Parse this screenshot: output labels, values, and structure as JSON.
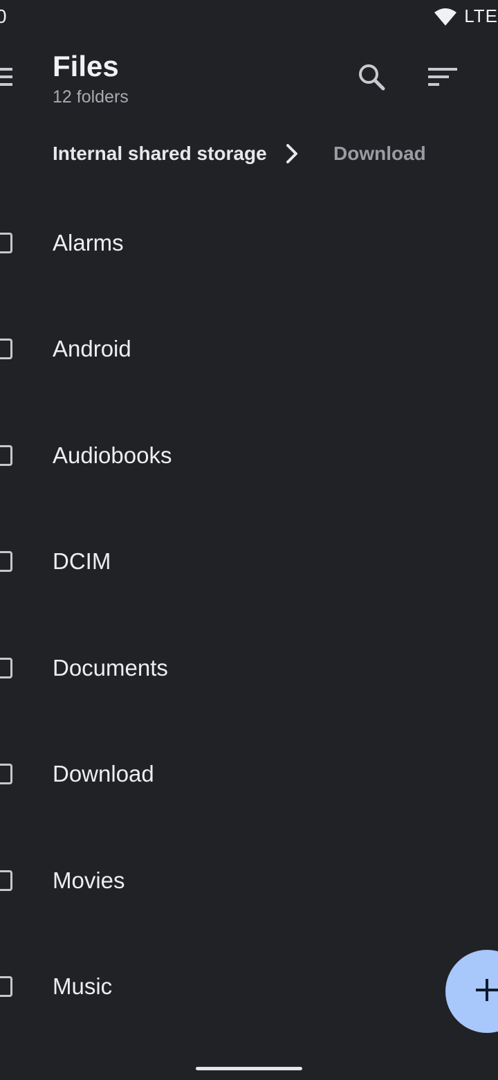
{
  "status_bar": {
    "time": "0",
    "network": "LTE",
    "icons": [
      "wifi-icon"
    ]
  },
  "app_bar": {
    "title": "Files",
    "subtitle": "12 folders",
    "icons": [
      "menu-icon",
      "search-icon",
      "sort-icon"
    ]
  },
  "breadcrumb": {
    "root": "Internal shared storage",
    "current": "Download",
    "separator_icon": "chevron-right-icon"
  },
  "folders": [
    {
      "name": "Alarms"
    },
    {
      "name": "Android"
    },
    {
      "name": "Audiobooks"
    },
    {
      "name": "DCIM"
    },
    {
      "name": "Documents"
    },
    {
      "name": "Download"
    },
    {
      "name": "Movies"
    },
    {
      "name": "Music"
    }
  ],
  "fab": {
    "icon": "plus-icon"
  },
  "colors": {
    "background": "#212226",
    "fab": "#a8c7fa",
    "text_primary": "#eeeef0",
    "text_secondary": "#a9aab0"
  }
}
